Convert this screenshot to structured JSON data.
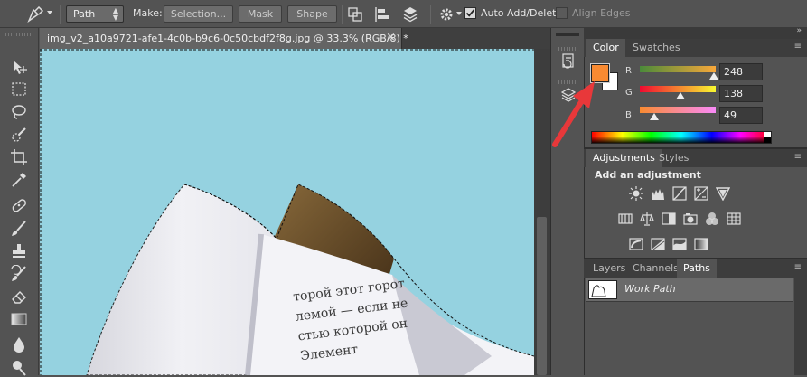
{
  "options_bar": {
    "mode_select": "Path",
    "make_label": "Make:",
    "selection_button": "Selection...",
    "mask_button": "Mask",
    "shape_button": "Shape",
    "auto_add_delete": {
      "label": "Auto Add/Delete",
      "checked": true
    },
    "align_edges": {
      "label": "Align Edges",
      "checked": false
    }
  },
  "document": {
    "tab_title": "img_v2_a10a9721-afe1-4c0b-b9c6-0c50cbdf2f8g.jpg @ 33.3% (RGB/8) *",
    "close_glyph": "×",
    "book_text": [
      "торой этот горот",
      "лемой — если не",
      "стью которой он",
      "Элемент"
    ]
  },
  "color_panel": {
    "tabs": [
      "Color",
      "Swatches"
    ],
    "active_tab": "Color",
    "foreground": "#f88a31",
    "background": "#ffffff",
    "channels": [
      {
        "label": "R",
        "value": "248",
        "fraction": 0.973
      },
      {
        "label": "G",
        "value": "138",
        "fraction": 0.541
      },
      {
        "label": "B",
        "value": "49",
        "fraction": 0.192
      }
    ]
  },
  "adjustments_panel": {
    "tabs": [
      "Adjustments",
      "Styles"
    ],
    "active_tab": "Adjustments",
    "heading": "Add an adjustment",
    "icons_row1": [
      "brightness-contrast-icon",
      "levels-icon",
      "curves-icon",
      "exposure-icon",
      "vibrance-icon"
    ],
    "icons_row2": [
      "hue-saturation-icon",
      "color-balance-icon",
      "black-white-icon",
      "photo-filter-icon",
      "channel-mixer-icon",
      "color-lookup-icon"
    ],
    "icons_row3": [
      "invert-icon",
      "posterize-icon",
      "threshold-icon",
      "gradient-map-icon"
    ]
  },
  "layers_panel": {
    "tabs": [
      "Layers",
      "Channels",
      "Paths"
    ],
    "active_tab": "Paths",
    "paths": [
      {
        "name": "Work Path"
      }
    ]
  },
  "colors": {
    "annotation_arrow": "#e8383a",
    "canvas_bg": "#95d2e0"
  }
}
